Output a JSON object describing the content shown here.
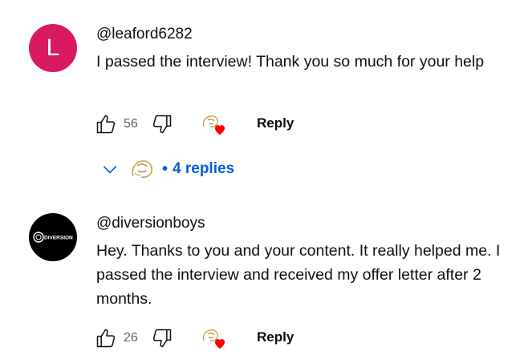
{
  "comments": [
    {
      "avatar_letter": "L",
      "avatar_color": "#d81b60",
      "author": "@leaford6282",
      "text": "I passed the interview! Thank you so much for your help",
      "likes": "56",
      "reply_label": "Reply"
    },
    {
      "avatar_logo_text": "DIVERSION",
      "avatar_color": "#000000",
      "author": "@diversionboys",
      "text": "Hey. Thanks to you and your content. It really helped me. I passed the interview and received my offer letter after 2 months.",
      "likes": "26",
      "reply_label": "Reply"
    }
  ],
  "replies_toggle": {
    "label": "4 replies",
    "separator": "•",
    "icon": "chevron-down-icon"
  },
  "colors": {
    "link": "#065fd4",
    "heart": "#ff0000",
    "muted": "#606060"
  }
}
